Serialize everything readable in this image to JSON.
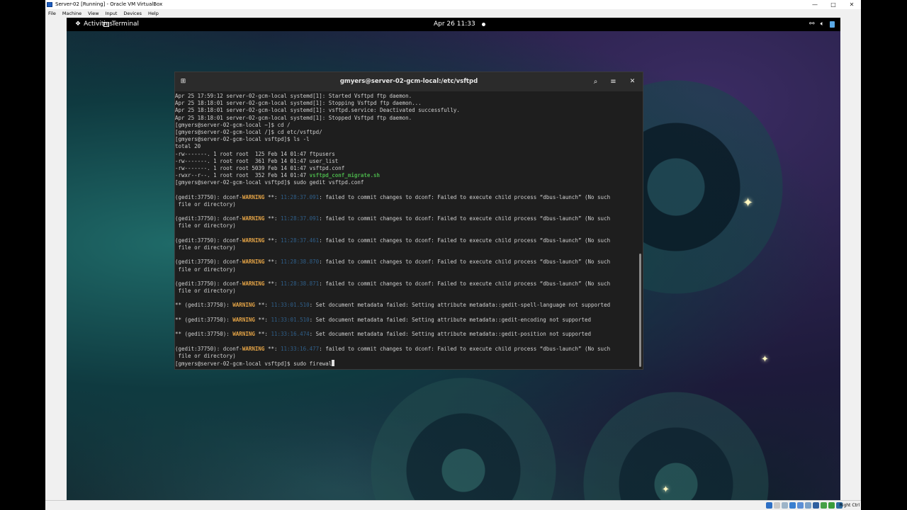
{
  "vbox": {
    "title": "Server-02 [Running] - Oracle VM VirtualBox",
    "menu": [
      "File",
      "Machine",
      "View",
      "Input",
      "Devices",
      "Help"
    ],
    "controls": {
      "minimize": "—",
      "maximize": "□",
      "close": "✕"
    },
    "host_key": "Right Ctrl"
  },
  "topbar": {
    "activities": "Activities",
    "app": "Terminal",
    "clock": "Apr 26  11:33"
  },
  "terminal": {
    "title": "gmyers@server-02-gcm-local:/etc/vsftpd",
    "lines": [
      {
        "t": "Apr 25 17:59:12 server-02-gcm-local systemd[1]: Started Vsftpd ftp daemon."
      },
      {
        "t": "Apr 25 18:18:01 server-02-gcm-local systemd[1]: Stopping Vsftpd ftp daemon..."
      },
      {
        "t": "Apr 25 18:18:01 server-02-gcm-local systemd[1]: vsftpd.service: Deactivated successfully."
      },
      {
        "t": "Apr 25 18:18:01 server-02-gcm-local systemd[1]: Stopped Vsftpd ftp daemon."
      },
      {
        "t": "[gmyers@server-02-gcm-local ~]$ cd /"
      },
      {
        "t": "[gmyers@server-02-gcm-local /]$ cd etc/vsftpd/"
      },
      {
        "t": "[gmyers@server-02-gcm-local vsftpd]$ ls -l"
      },
      {
        "t": "total 20"
      },
      {
        "t": "-rw-------. 1 root root  125 Feb 14 01:47 ftpusers"
      },
      {
        "t": "-rw-------. 1 root root  361 Feb 14 01:47 user_list"
      },
      {
        "t": "-rw-------. 1 root root 5039 Feb 14 01:47 vsftpd.conf"
      },
      {
        "t": "-rwxr--r--. 1 root root  352 Feb 14 01:47 ",
        "exe": "vsftpd_conf_migrate.sh"
      },
      {
        "t": "[gmyers@server-02-gcm-local vsftpd]$ sudo gedit vsftpd.conf"
      },
      {
        "t": ""
      },
      {
        "pre": "(gedit:37750): dconf-",
        "warn": "WARNING",
        "mid": " **: ",
        "ts": "11:28:37.091",
        "post": ": failed to commit changes to dconf: Failed to execute child process “dbus-launch” (No such"
      },
      {
        "t": " file or directory)"
      },
      {
        "t": ""
      },
      {
        "pre": "(gedit:37750): dconf-",
        "warn": "WARNING",
        "mid": " **: ",
        "ts": "11:28:37.091",
        "post": ": failed to commit changes to dconf: Failed to execute child process “dbus-launch” (No such"
      },
      {
        "t": " file or directory)"
      },
      {
        "t": ""
      },
      {
        "pre": "(gedit:37750): dconf-",
        "warn": "WARNING",
        "mid": " **: ",
        "ts": "11:28:37.461",
        "post": ": failed to commit changes to dconf: Failed to execute child process “dbus-launch” (No such"
      },
      {
        "t": " file or directory)"
      },
      {
        "t": ""
      },
      {
        "pre": "(gedit:37750): dconf-",
        "warn": "WARNING",
        "mid": " **: ",
        "ts": "11:28:38.870",
        "post": ": failed to commit changes to dconf: Failed to execute child process “dbus-launch” (No such"
      },
      {
        "t": " file or directory)"
      },
      {
        "t": ""
      },
      {
        "pre": "(gedit:37750): dconf-",
        "warn": "WARNING",
        "mid": " **: ",
        "ts": "11:28:38.871",
        "post": ": failed to commit changes to dconf: Failed to execute child process “dbus-launch” (No such"
      },
      {
        "t": " file or directory)"
      },
      {
        "t": ""
      },
      {
        "pre": "** (gedit:37750): ",
        "warn": "WARNING",
        "mid": " **: ",
        "ts": "11:33:01.510",
        "post": ": Set document metadata failed: Setting attribute metadata::gedit-spell-language not supported"
      },
      {
        "t": ""
      },
      {
        "pre": "** (gedit:37750): ",
        "warn": "WARNING",
        "mid": " **: ",
        "ts": "11:33:01.510",
        "post": ": Set document metadata failed: Setting attribute metadata::gedit-encoding not supported"
      },
      {
        "t": ""
      },
      {
        "pre": "** (gedit:37750): ",
        "warn": "WARNING",
        "mid": " **: ",
        "ts": "11:33:16.474",
        "post": ": Set document metadata failed: Setting attribute metadata::gedit-position not supported"
      },
      {
        "t": ""
      },
      {
        "pre": "(gedit:37750): dconf-",
        "warn": "WARNING",
        "mid": " **: ",
        "ts": "11:33:16.477",
        "post": ": failed to commit changes to dconf: Failed to execute child process “dbus-launch” (No such"
      },
      {
        "t": " file or directory)"
      },
      {
        "t": "[gmyers@server-02-gcm-local vsftpd]$ sudo firewal",
        "cursor": true
      }
    ]
  },
  "colors": {
    "warning": "#e3a346",
    "timestamp": "#2f5f8a",
    "executable": "#4ab14a",
    "terminal_bg": "#1e1e1e"
  },
  "icons": {
    "activities": "gnome-foot-icon",
    "terminal": "terminal-icon",
    "new_tab": "new-tab-icon",
    "search": "search-icon",
    "menu": "hamburger-menu-icon",
    "close": "close-icon",
    "tray": [
      "network-icon",
      "volume-icon",
      "battery-icon"
    ]
  }
}
